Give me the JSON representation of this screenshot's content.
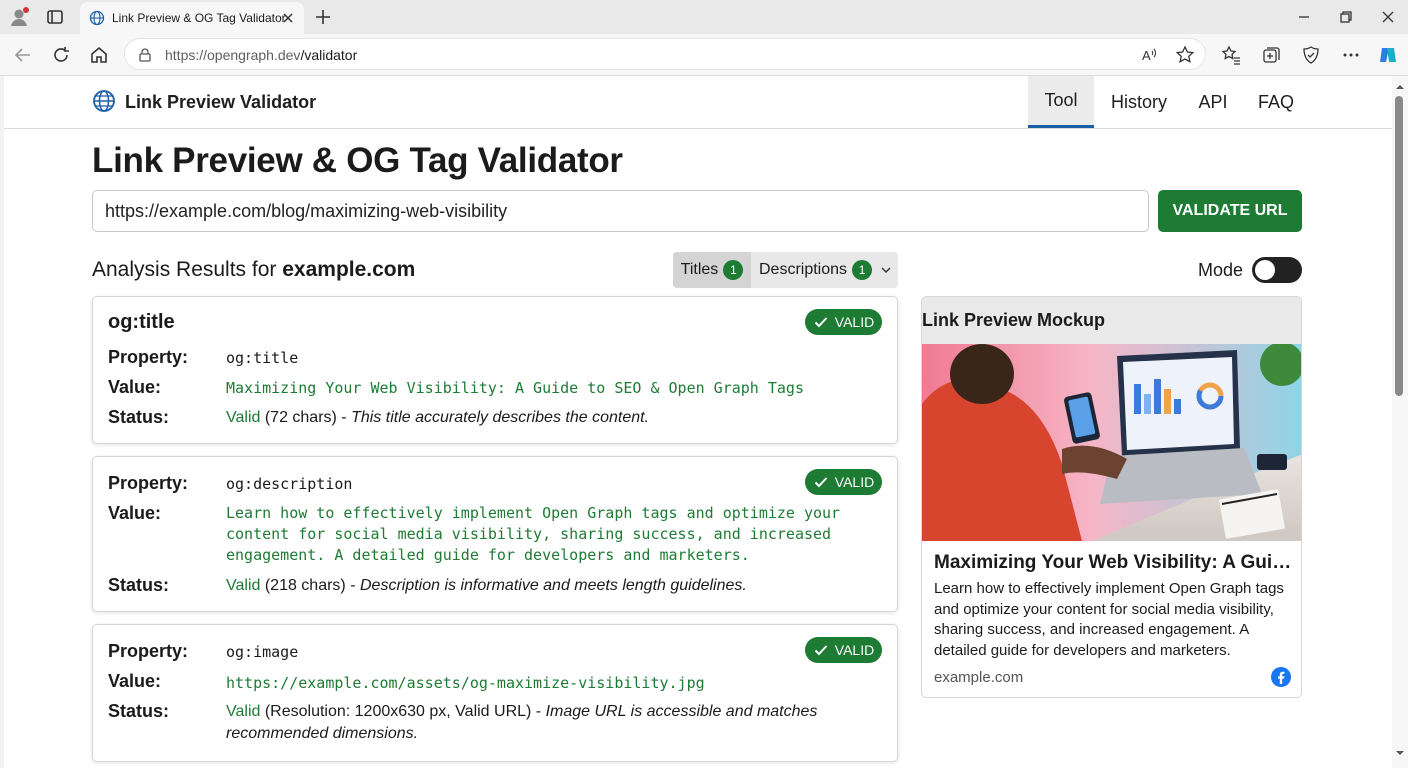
{
  "browser": {
    "tab_title": "Link Preview & OG Tag Validator",
    "url_host": "https://opengraph.dev",
    "url_path": "/validator"
  },
  "site": {
    "brand": "Link Preview Validator",
    "nav": [
      "Tool",
      "History",
      "API",
      "FAQ"
    ],
    "active_nav": "Tool"
  },
  "page": {
    "title": "Link Preview & OG Tag Validator",
    "url_value": "https://example.com/blog/maximizing-web-visibility",
    "validate_label": "VALIDATE URL",
    "results_prefix": "Analysis Results for ",
    "results_domain": "example.com",
    "filters": [
      {
        "label": "Titles",
        "count": "1"
      },
      {
        "label": "Descriptions",
        "count": "1"
      }
    ],
    "mode_label": "Mode"
  },
  "labels": {
    "property": "Property:",
    "value": "Value:",
    "status": "Status:",
    "valid_badge": "VALID"
  },
  "cards": [
    {
      "heading": "og:title",
      "property": "og:title",
      "value": "Maximizing Your Web Visibility: A Guide to SEO & Open Graph Tags",
      "status_word": "Valid",
      "status_detail": " (72 chars) - ",
      "status_note": "This title accurately describes the content."
    },
    {
      "property": "og:description",
      "value": "Learn how to effectively implement Open Graph tags and optimize your content for social media visibility, sharing success, and increased engagement. A detailed guide for developers and marketers.",
      "status_word": "Valid",
      "status_detail": " (218 chars) - ",
      "status_note": "Description is informative and meets length guidelines."
    },
    {
      "property": "og:image",
      "value": "https://example.com/assets/og-maximize-visibility.jpg",
      "status_word": "Valid",
      "status_detail": " (Resolution: 1200x630 px, Valid URL) - ",
      "status_note": "Image URL is accessible and matches recommended dimensions."
    }
  ],
  "preview": {
    "heading": "Link Preview Mockup",
    "title": "Maximizing Your Web Visibility: A Guide...",
    "description": "Learn how to effectively implement Open Graph tags and optimize your content for social media visibility, sharing success, and increased engagement. A detailed guide for developers and marketers.",
    "domain": "example.com"
  },
  "colors": {
    "accent_green": "#1e7b34",
    "nav_underline": "#1d5fa6",
    "facebook_blue": "#1877f2"
  }
}
